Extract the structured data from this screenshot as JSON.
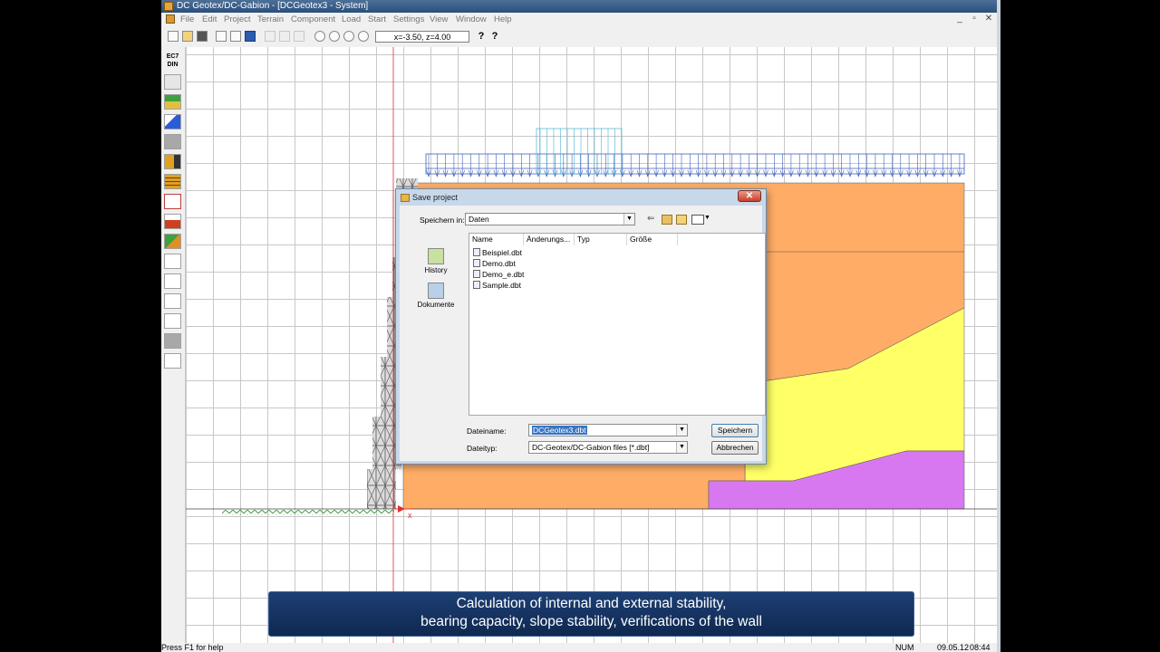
{
  "window": {
    "title": "DC Geotex/DC-Gabion - [DCGeotex3 - System]",
    "controls": [
      "_",
      "▫",
      "✕"
    ]
  },
  "menu": [
    "File",
    "Edit",
    "Project",
    "Terrain",
    "Component",
    "Load",
    "Start",
    "Settings",
    "View",
    "Window",
    "Help"
  ],
  "toolbar": {
    "coordinates": "x=-3.50, z=4.00",
    "help_label": "?",
    "context_help_label": "?"
  },
  "left_toolbar": {
    "standard_badge": "EC7 DIN"
  },
  "dialog": {
    "title": "Save project",
    "close_label": "✕",
    "look_in_label": "Speichern in:",
    "look_in_value": "Daten",
    "places": [
      {
        "label": "History"
      },
      {
        "label": "Dokumente"
      }
    ],
    "columns": [
      "Name",
      "Änderungs...",
      "Typ",
      "Größe"
    ],
    "files": [
      "Beispiel.dbt",
      "Demo.dbt",
      "Demo_e.dbt",
      "Sample.dbt"
    ],
    "filename_label": "Dateiname:",
    "filename_value": "DCGeotex3.dbt",
    "filetype_label": "Dateityp:",
    "filetype_value": "DC-Geotex/DC-Gabion files [*.dbt]",
    "save_button": "Speichern",
    "cancel_button": "Abbrechen"
  },
  "canvas": {
    "origin_x_label": "x"
  },
  "caption": {
    "line1": "Calculation of internal and external stability,",
    "line2": "bearing capacity, slope stability, verifications of the wall"
  },
  "status": {
    "help": "Press F1 for help",
    "num": "NUM",
    "date": "09.05.12",
    "time": "08:44"
  },
  "colors": {
    "soil_orange": "#ffad66",
    "soil_yellow": "#ffff66",
    "soil_purple": "#d878f0",
    "load_blue": "#3f5fbf",
    "axis_red": "#e23030",
    "caption_bg": "#16366a",
    "titlebar": "#3a5f8c"
  }
}
